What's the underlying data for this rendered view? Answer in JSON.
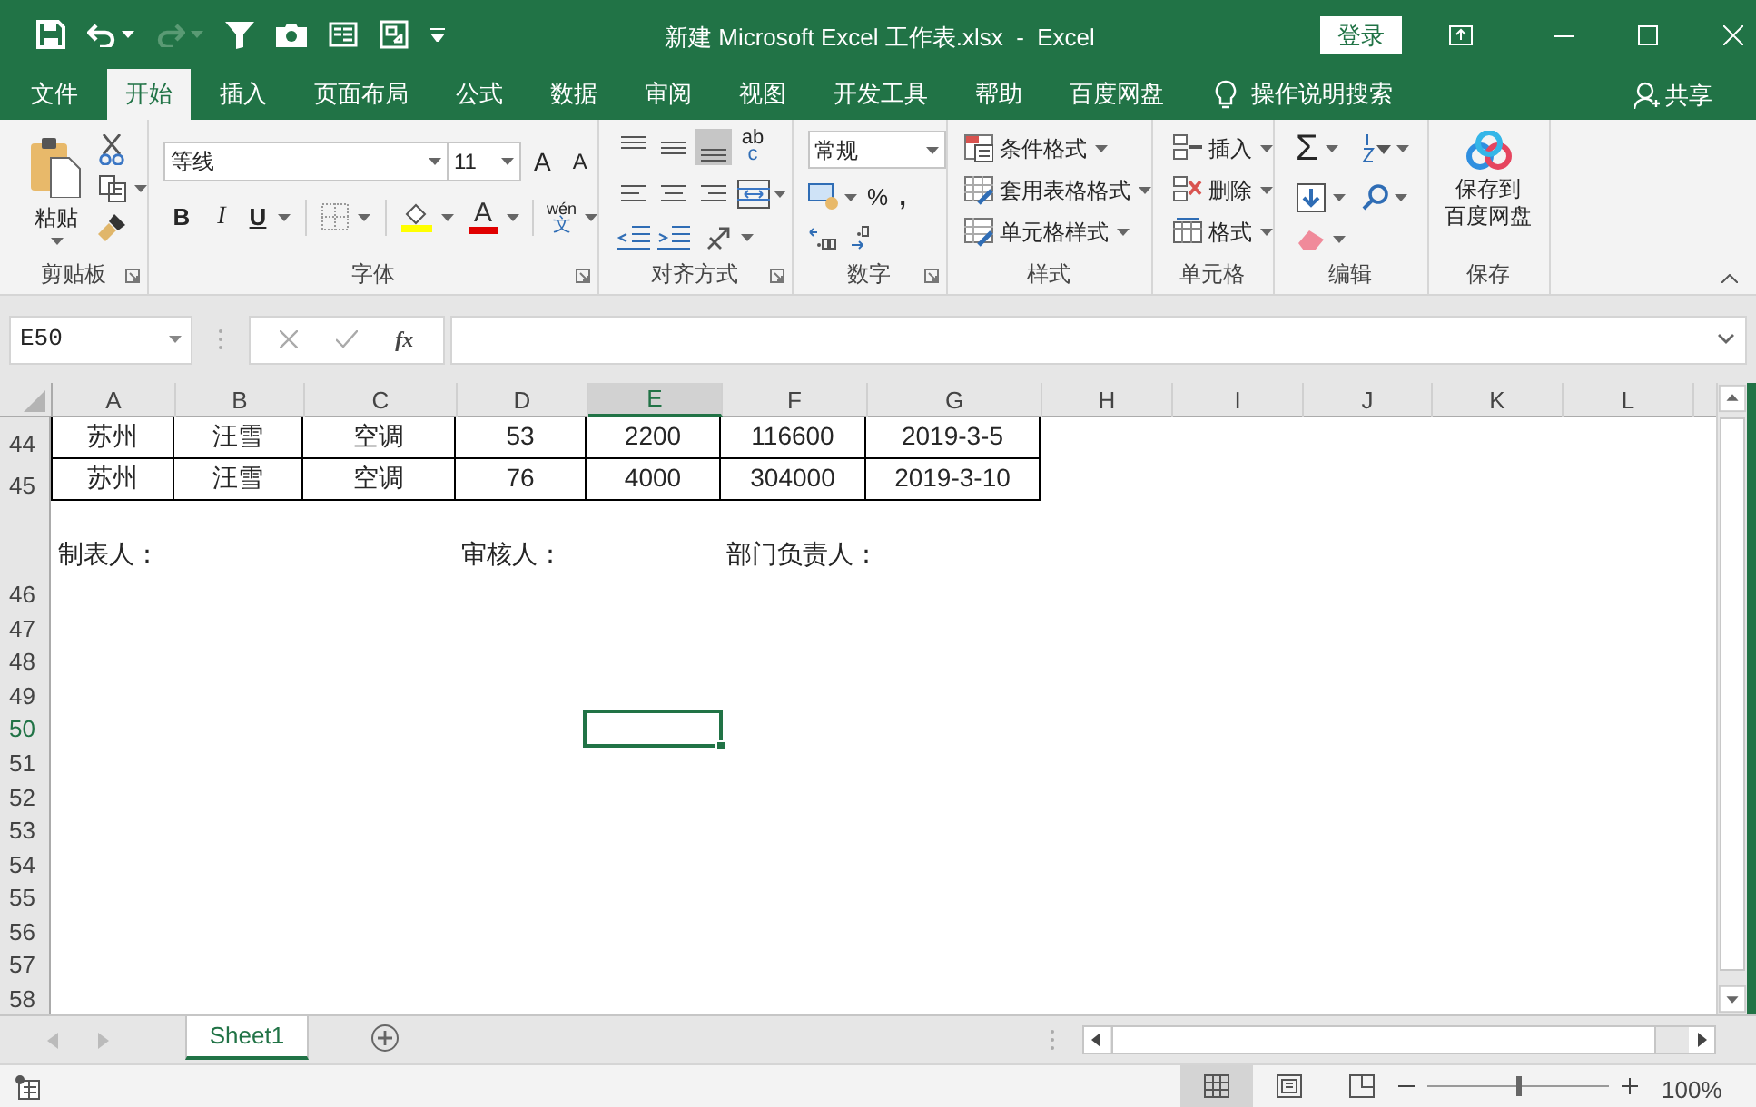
{
  "window": {
    "title": "新建 Microsoft Excel 工作表.xlsx  -  Excel",
    "sign_in": "登录"
  },
  "quick_access": [
    {
      "kind": "save",
      "disabled": false
    },
    {
      "kind": "undo",
      "disabled": false
    },
    {
      "kind": "redo",
      "disabled": true
    },
    {
      "kind": "filter",
      "disabled": false
    },
    {
      "kind": "camera",
      "disabled": false
    },
    {
      "kind": "form",
      "disabled": false
    },
    {
      "kind": "picture",
      "disabled": false
    },
    {
      "kind": "customize",
      "disabled": false
    }
  ],
  "tabs": [
    {
      "label": "文件",
      "selected": false
    },
    {
      "label": "开始",
      "selected": true
    },
    {
      "label": "插入",
      "selected": false
    },
    {
      "label": "页面布局",
      "selected": false
    },
    {
      "label": "公式",
      "selected": false
    },
    {
      "label": "数据",
      "selected": false
    },
    {
      "label": "审阅",
      "selected": false
    },
    {
      "label": "视图",
      "selected": false
    },
    {
      "label": "开发工具",
      "selected": false
    },
    {
      "label": "帮助",
      "selected": false
    },
    {
      "label": "百度网盘",
      "selected": false
    }
  ],
  "tell_me": "操作说明搜索",
  "share": "共享",
  "ribbon": {
    "clipboard": {
      "label": "剪贴板",
      "paste": "粘贴"
    },
    "font": {
      "label": "字体",
      "font_name": "等线",
      "font_size": "11",
      "grow": "A",
      "shrink": "A",
      "bold": "B",
      "italic": "I",
      "underline": "U",
      "font_color": "A",
      "phonetic_top": "wén",
      "phonetic_bottom": "文"
    },
    "alignment": {
      "label": "对齐方式",
      "wrap_top": "ab",
      "wrap_bottom": "c"
    },
    "number": {
      "label": "数字",
      "format": "常规",
      "percent": "%",
      "comma": ","
    },
    "styles": {
      "label": "样式",
      "items": [
        "条件格式",
        "套用表格格式",
        "单元格样式"
      ]
    },
    "cells": {
      "label": "单元格",
      "items": [
        "插入",
        "删除",
        "格式"
      ]
    },
    "editing": {
      "label": "编辑",
      "sum": "Σ"
    },
    "save": {
      "label": "保存",
      "button_lines": [
        "保存到",
        "百度网盘"
      ]
    }
  },
  "formula_bar": {
    "name_box": "E50",
    "fx": "fx"
  },
  "sheet": {
    "columns": [
      {
        "label": "A",
        "selected": false
      },
      {
        "label": "B",
        "selected": false
      },
      {
        "label": "C",
        "selected": false
      },
      {
        "label": "D",
        "selected": false
      },
      {
        "label": "E",
        "selected": true
      },
      {
        "label": "F",
        "selected": false
      },
      {
        "label": "G",
        "selected": false
      },
      {
        "label": "H",
        "selected": false
      },
      {
        "label": "I",
        "selected": false
      },
      {
        "label": "J",
        "selected": false
      },
      {
        "label": "K",
        "selected": false
      },
      {
        "label": "L",
        "selected": false
      }
    ],
    "rows": [
      {
        "number": "44",
        "kind": "table",
        "selected": false,
        "cells": [
          "苏州",
          "汪雪",
          "空调",
          "53",
          "2200",
          "116600",
          "2019-3-5"
        ]
      },
      {
        "number": "45",
        "kind": "table",
        "selected": false,
        "cells": [
          "苏州",
          "汪雪",
          "空调",
          "76",
          "4000",
          "304000",
          "2019-3-10"
        ]
      },
      {
        "number": "46",
        "kind": "notes",
        "selected": false,
        "notes": [
          "制表人：",
          "审核人：",
          "部门负责人："
        ]
      },
      {
        "number": "47",
        "kind": "empty",
        "selected": false
      },
      {
        "number": "48",
        "kind": "empty",
        "selected": false
      },
      {
        "number": "49",
        "kind": "empty",
        "selected": false
      },
      {
        "number": "50",
        "kind": "empty",
        "selected": true
      },
      {
        "number": "51",
        "kind": "empty",
        "selected": false
      },
      {
        "number": "52",
        "kind": "empty",
        "selected": false
      },
      {
        "number": "53",
        "kind": "empty",
        "selected": false
      },
      {
        "number": "54",
        "kind": "empty",
        "selected": false
      },
      {
        "number": "55",
        "kind": "empty",
        "selected": false
      },
      {
        "number": "56",
        "kind": "empty",
        "selected": false
      },
      {
        "number": "57",
        "kind": "empty",
        "selected": false
      },
      {
        "number": "58",
        "kind": "empty",
        "selected": false
      }
    ]
  },
  "sheet_tabs": [
    {
      "label": "Sheet1",
      "selected": true
    }
  ],
  "status_bar": {
    "views": [
      {
        "kind": "normal",
        "selected": true
      },
      {
        "kind": "page_layout",
        "selected": false
      },
      {
        "kind": "page_break",
        "selected": false
      }
    ],
    "zoom_slider": {
      "level": 0.5
    },
    "zoom": "100%"
  }
}
